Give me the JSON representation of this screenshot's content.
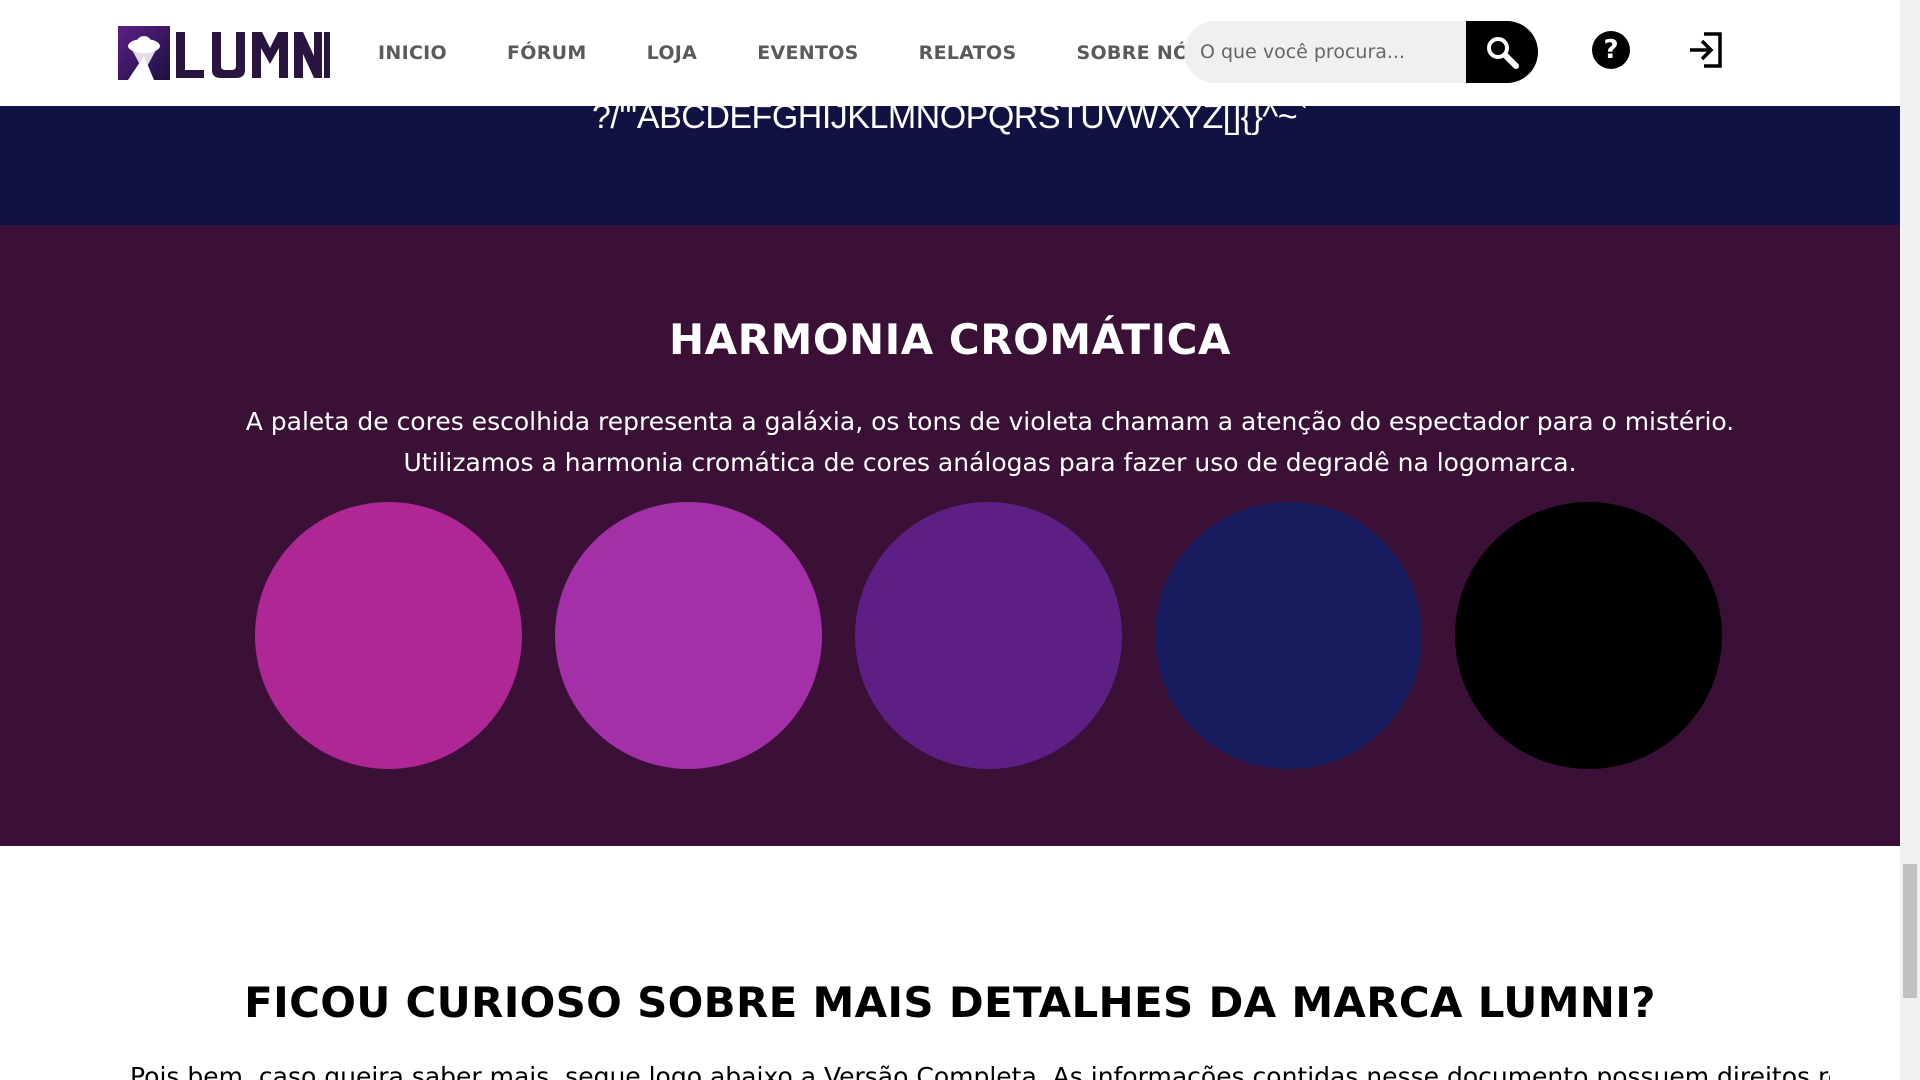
{
  "brand": {
    "name": "LUMNI",
    "logo_icon": "ufo-logo-icon"
  },
  "nav": {
    "items": [
      {
        "label": "INICIO"
      },
      {
        "label": "FÓRUM"
      },
      {
        "label": "LOJA"
      },
      {
        "label": "EVENTOS"
      },
      {
        "label": "RELATOS"
      },
      {
        "label": "SOBRE NÓS"
      }
    ]
  },
  "search": {
    "placeholder": "O que você procura...",
    "value": "",
    "button_icon": "search-icon"
  },
  "header_actions": {
    "help_icon": "help-icon",
    "help_glyph": "?",
    "login_icon": "login-icon"
  },
  "typography_sample": {
    "glyphs": "?/\"'ABCDEFGHIJKLMNOPQRSTUVWXYZ[]{}^~`"
  },
  "harmony": {
    "title": "HARMONIA CROMÁTICA",
    "description": "A paleta de cores escolhida representa a galáxia, os tons de violeta chamam a atenção do espectador para o mistério. Utilizamos a harmonia cromática de cores análogas para fazer uso de degradê na logomarca.",
    "background": "#3a1037",
    "swatches": [
      {
        "color": "#ae2795"
      },
      {
        "color": "#a32fa9"
      },
      {
        "color": "#5e1f85"
      },
      {
        "color": "#161b5e"
      },
      {
        "color": "#000000"
      }
    ]
  },
  "colors": {
    "navy_band": "#101242",
    "accent_black": "#000000"
  },
  "cta": {
    "title": "FICOU CURIOSO SOBRE MAIS DETALHES DA MARCA LUMNI?",
    "text": "Pois bem, caso queira saber mais, segue logo abaixo a Versão Completa. As informações contidas nesse documento possuem direitos reservados"
  }
}
